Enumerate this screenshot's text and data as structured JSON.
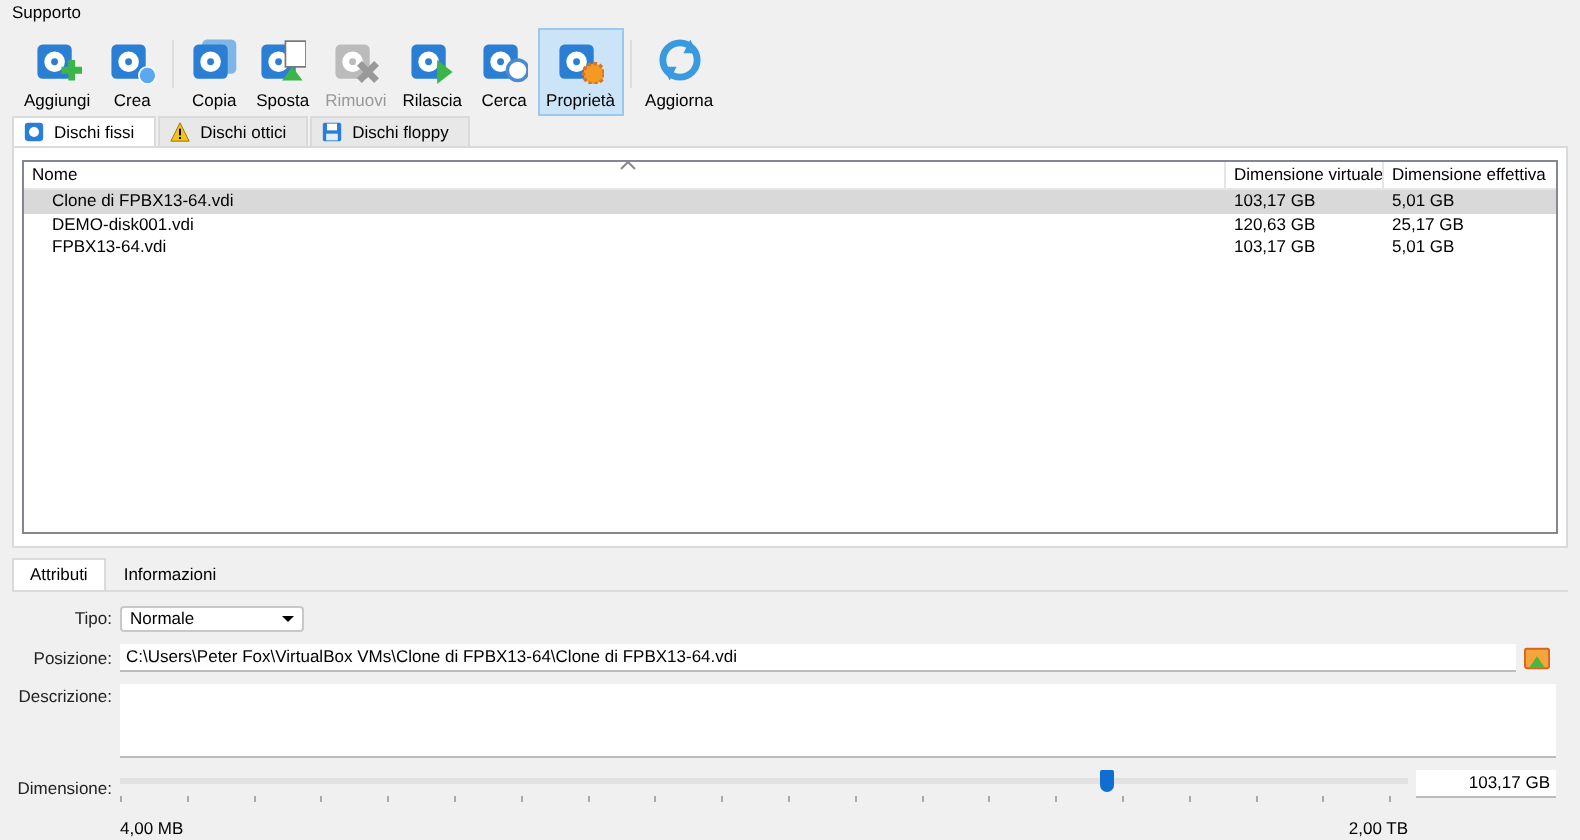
{
  "window": {
    "title": "Supporto"
  },
  "toolbar": [
    {
      "label": "Aggiungi",
      "kind": "add",
      "disabled": false,
      "selected": false
    },
    {
      "label": "Crea",
      "kind": "create",
      "disabled": false,
      "selected": false
    },
    {
      "label": "Copia",
      "kind": "copy",
      "disabled": false,
      "selected": false
    },
    {
      "label": "Sposta",
      "kind": "move",
      "disabled": false,
      "selected": false
    },
    {
      "label": "Rimuovi",
      "kind": "remove",
      "disabled": true,
      "selected": false
    },
    {
      "label": "Rilascia",
      "kind": "release",
      "disabled": false,
      "selected": false
    },
    {
      "label": "Cerca",
      "kind": "search",
      "disabled": false,
      "selected": false
    },
    {
      "label": "Proprietà",
      "kind": "properties",
      "disabled": false,
      "selected": true
    },
    {
      "label": "Aggiorna",
      "kind": "refresh",
      "disabled": false,
      "selected": false
    }
  ],
  "tabs": [
    {
      "label": "Dischi fissi",
      "kind": "hdd",
      "selected": true
    },
    {
      "label": "Dischi ottici",
      "kind": "optical",
      "selected": false
    },
    {
      "label": "Dischi floppy",
      "kind": "floppy",
      "selected": false
    }
  ],
  "table": {
    "columns": [
      "Nome",
      "Dimensione virtuale",
      "Dimensione effettiva"
    ],
    "rows": [
      {
        "cells": [
          "Clone di FPBX13-64.vdi",
          "103,17 GB",
          "5,01 GB"
        ],
        "selected": true
      },
      {
        "cells": [
          "DEMO-disk001.vdi",
          "120,63 GB",
          "25,17 GB"
        ],
        "selected": false
      },
      {
        "cells": [
          "FPBX13-64.vdi",
          "103,17 GB",
          "5,01 GB"
        ],
        "selected": false
      }
    ]
  },
  "detail_tabs": [
    {
      "label": "Attributi",
      "selected": true
    },
    {
      "label": "Informazioni",
      "selected": false
    }
  ],
  "attributes": {
    "type_label": "Tipo:",
    "type_value": "Normale",
    "location_label": "Posizione:",
    "location_value": "C:\\Users\\Peter Fox\\VirtualBox VMs\\Clone di FPBX13-64\\Clone di FPBX13-64.vdi",
    "description_label": "Descrizione:",
    "size_label": "Dimensione:",
    "size": {
      "level": 0.766,
      "min": "4,00 MB",
      "max": "2,00 TB",
      "value": "103,17 GB"
    }
  }
}
